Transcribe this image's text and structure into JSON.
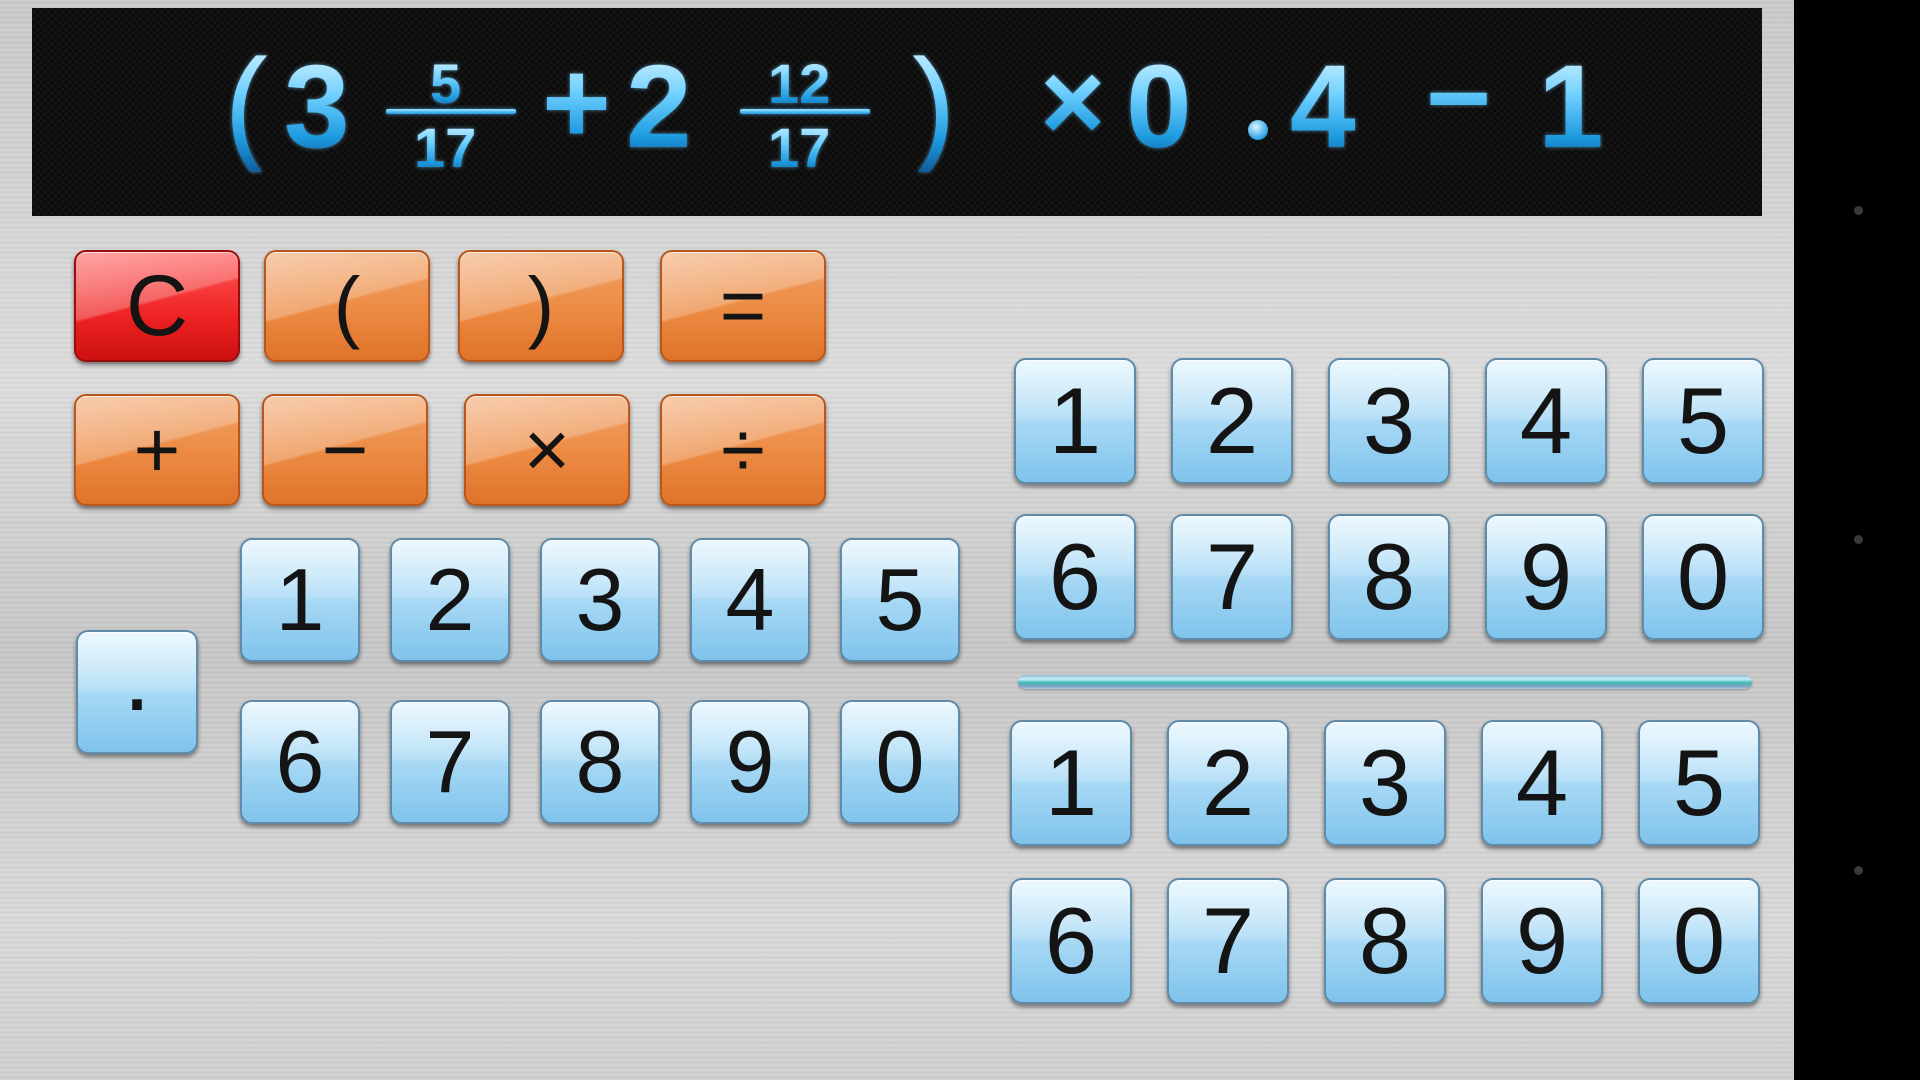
{
  "display": {
    "expression": [
      {
        "kind": "paren",
        "text": "("
      },
      {
        "kind": "whole",
        "text": "3"
      },
      {
        "kind": "fraction",
        "numerator": "5",
        "denominator": "17"
      },
      {
        "kind": "operator",
        "text": "+"
      },
      {
        "kind": "whole",
        "text": "2"
      },
      {
        "kind": "fraction",
        "numerator": "12",
        "denominator": "17"
      },
      {
        "kind": "paren",
        "text": ")"
      },
      {
        "kind": "operator",
        "text": "×"
      },
      {
        "kind": "number",
        "text": "0"
      },
      {
        "kind": "decimal_point",
        "text": "."
      },
      {
        "kind": "number",
        "text": "4"
      },
      {
        "kind": "operator",
        "text": "−"
      },
      {
        "kind": "number",
        "text": "1"
      }
    ]
  },
  "operators": {
    "clear": "C",
    "open_paren": "(",
    "close_paren": ")",
    "equals": "=",
    "plus": "+",
    "minus": "−",
    "multiply": "×",
    "divide": "÷"
  },
  "decimal_point": ".",
  "whole_keypad": [
    "1",
    "2",
    "3",
    "4",
    "5",
    "6",
    "7",
    "8",
    "9",
    "0"
  ],
  "numerator_keypad": [
    "1",
    "2",
    "3",
    "4",
    "5",
    "6",
    "7",
    "8",
    "9",
    "0"
  ],
  "denominator_keypad": [
    "1",
    "2",
    "3",
    "4",
    "5",
    "6",
    "7",
    "8",
    "9",
    "0"
  ],
  "colors": {
    "display_text": "#4fc3f7",
    "clear_button": "#ee2222",
    "operator_button": "#ec8a42",
    "digit_button": "#a8d9f5"
  }
}
